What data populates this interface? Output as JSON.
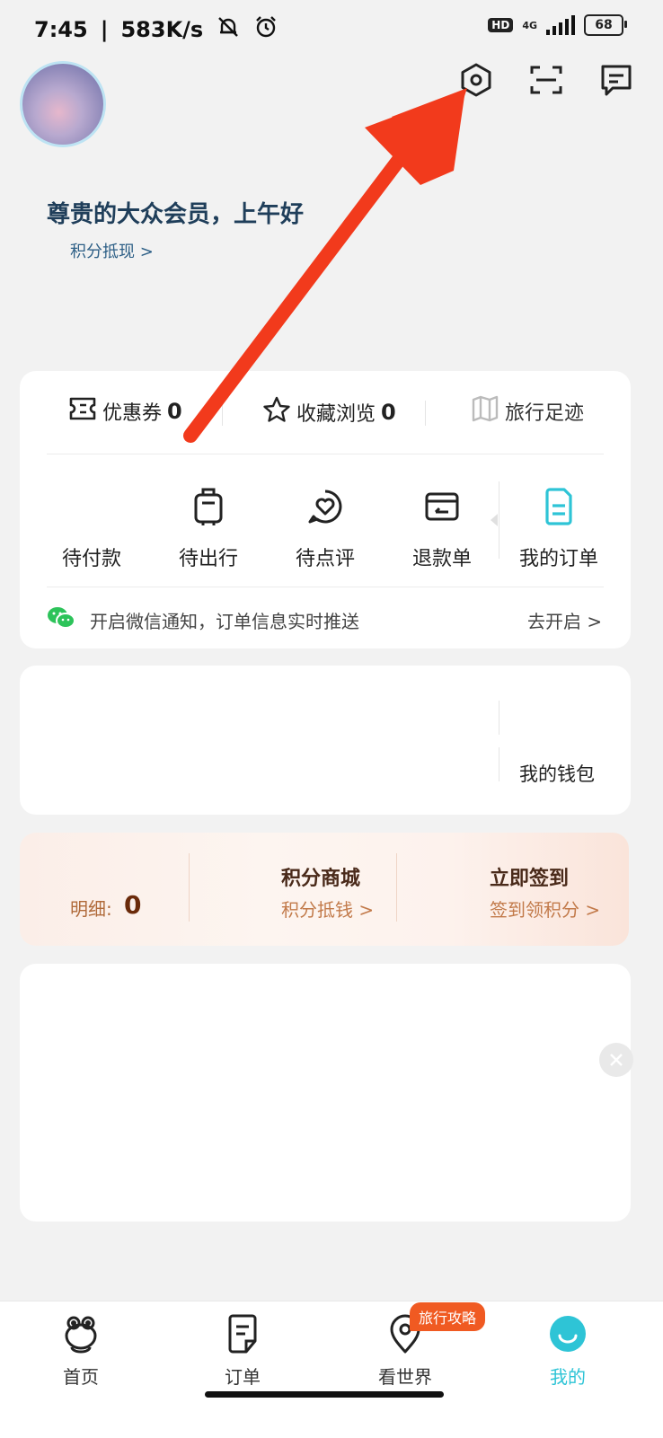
{
  "status_bar": {
    "time": "7:45",
    "speed": "583K/s",
    "hd": "HD",
    "network": "4G",
    "battery": "68"
  },
  "header": {
    "greeting": "尊贵的大众会员，上午好",
    "points_link": "积分抵现 >"
  },
  "icons": {
    "settings": "settings-hexagon-icon",
    "scan": "scan-icon",
    "message": "message-icon"
  },
  "stats": [
    {
      "label": "优惠券",
      "value": "0"
    },
    {
      "label": "收藏浏览",
      "value": "0"
    },
    {
      "label": "旅行足迹",
      "value": ""
    }
  ],
  "orders": [
    {
      "label": "待付款"
    },
    {
      "label": "待出行"
    },
    {
      "label": "待点评"
    },
    {
      "label": "退款单"
    },
    {
      "label": "我的订单"
    }
  ],
  "wechat_notice": {
    "text": "开启微信通知，订单信息实时推送",
    "action": "去开启 >"
  },
  "wallet": {
    "label": "我的钱包"
  },
  "points": {
    "detail_label": "明细:",
    "detail_value": "0",
    "mall_title": "积分商城",
    "mall_sub": "积分抵钱 >",
    "sign_title": "立即签到",
    "sign_sub": "签到领积分 >"
  },
  "bottom_nav": [
    {
      "label": "首页"
    },
    {
      "label": "订单"
    },
    {
      "label": "看世界"
    },
    {
      "label": "我的"
    }
  ],
  "nav_badge": "旅行攻略",
  "colors": {
    "accent": "#2ec4d6",
    "arrow": "#f23a1c",
    "badge": "#f05a22"
  }
}
